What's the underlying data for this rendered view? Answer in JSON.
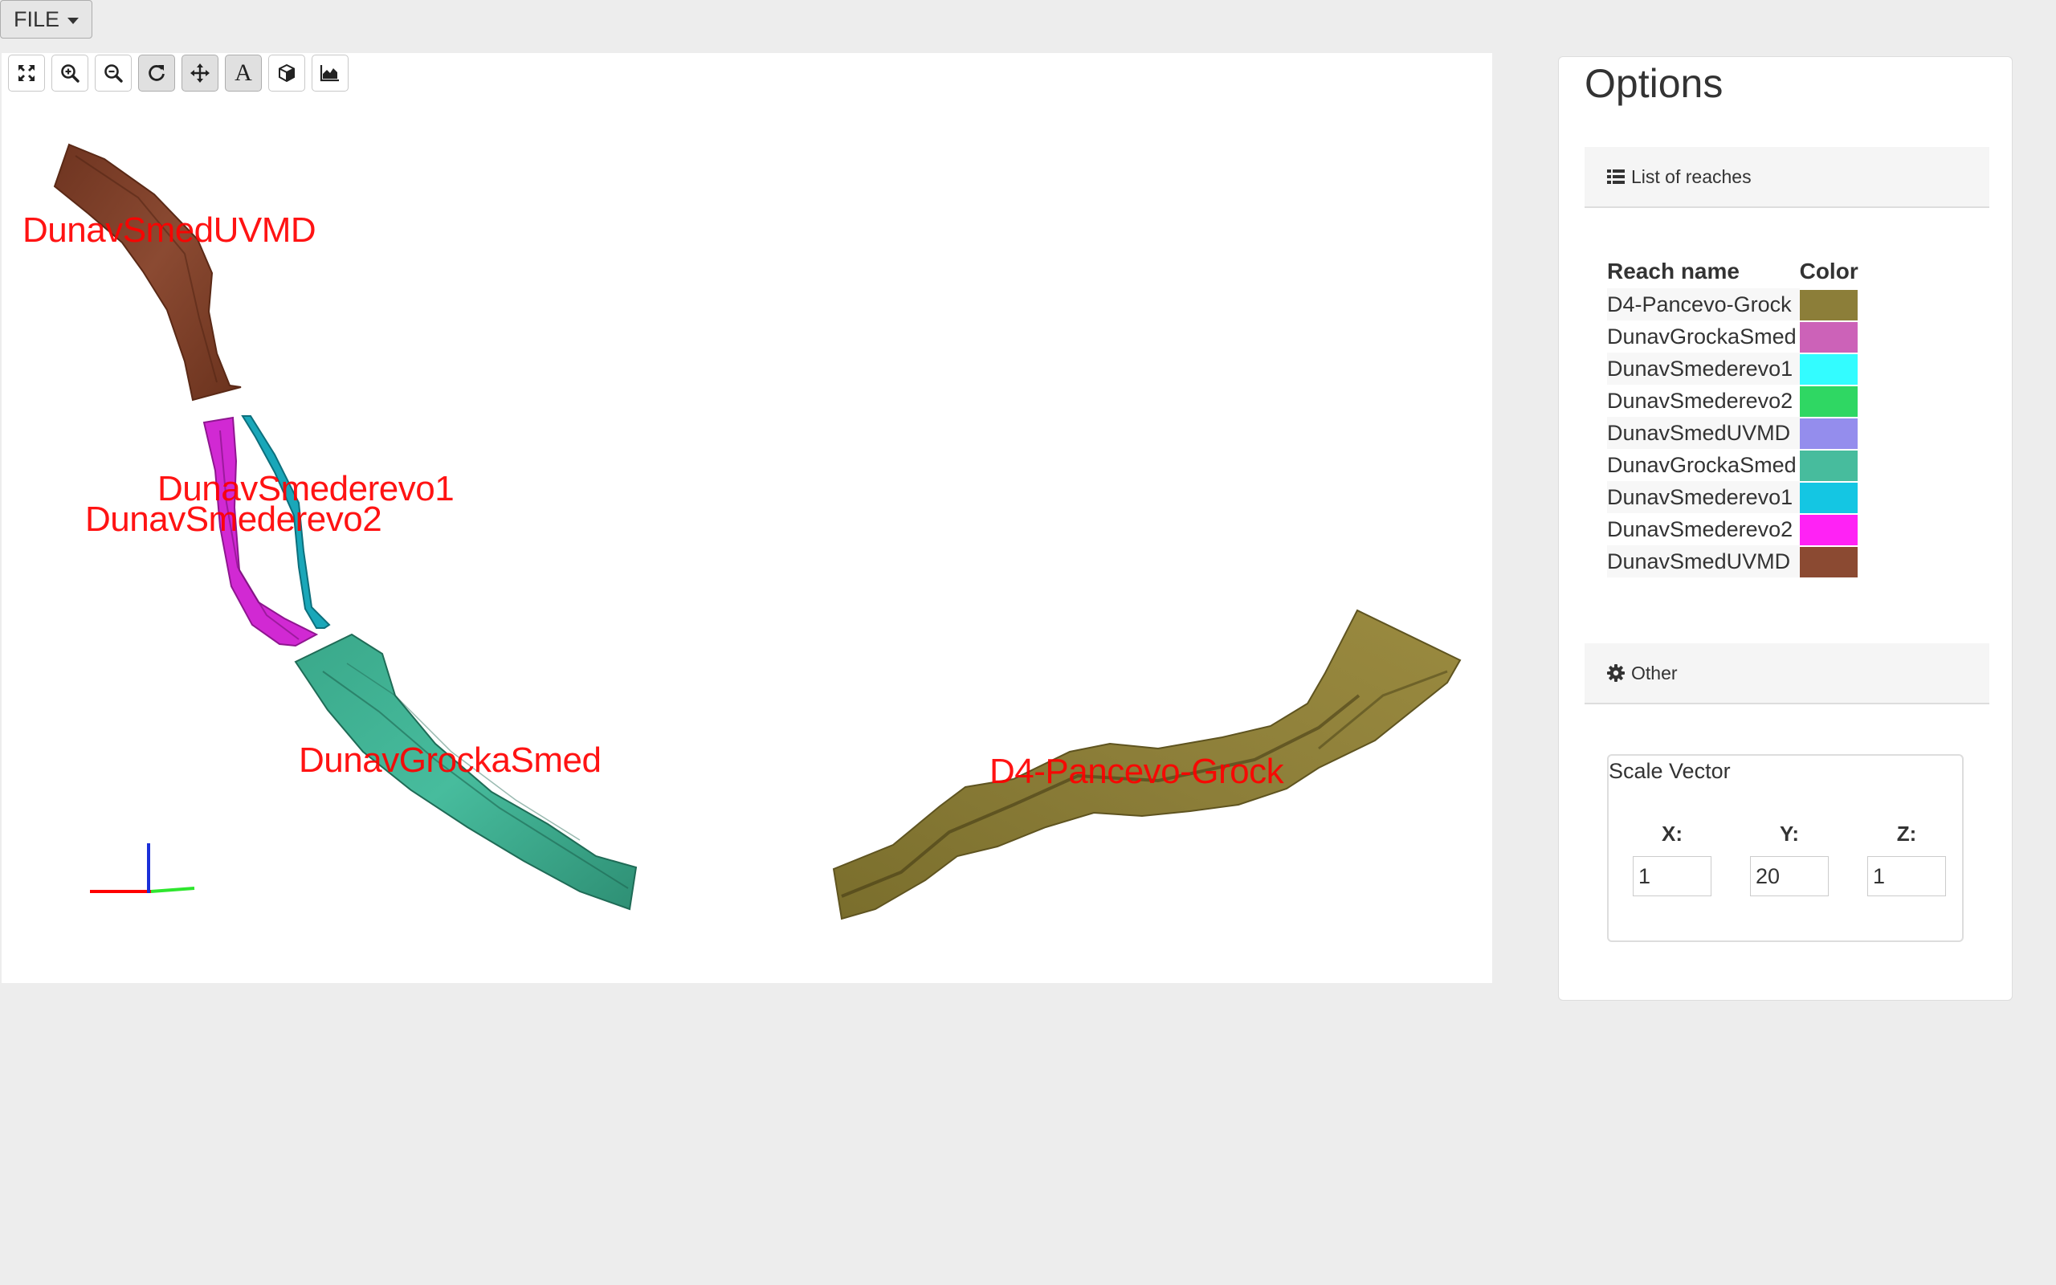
{
  "menu": {
    "file_label": "FILE"
  },
  "toolbar": {
    "buttons": [
      {
        "icon": "fullscreen-icon"
      },
      {
        "icon": "zoom-in-icon"
      },
      {
        "icon": "zoom-out-icon"
      },
      {
        "icon": "rotate-icon"
      },
      {
        "icon": "pan-icon"
      },
      {
        "icon": "text-labels-icon",
        "glyph": "A"
      },
      {
        "icon": "cube-icon"
      },
      {
        "icon": "area-chart-icon"
      }
    ]
  },
  "viewer": {
    "labels": [
      "DunavSmedUVMD",
      "DunavSmederevo1",
      "DunavSmederevo2",
      "DunavGrockaSmed",
      "D4-Pancevo-Grock"
    ]
  },
  "options": {
    "title": "Options",
    "reaches_header": "List of reaches",
    "table_headers": {
      "name": "Reach name",
      "color": "Color"
    },
    "reaches": [
      {
        "name": "D4-Pancevo-Grock",
        "color": "#8c7e39"
      },
      {
        "name": "DunavGrockaSmed",
        "color": "#cc62b8"
      },
      {
        "name": "DunavSmederevo1",
        "color": "#33fcff"
      },
      {
        "name": "DunavSmederevo2",
        "color": "#2fd763"
      },
      {
        "name": "DunavSmedUVMD",
        "color": "#948ded"
      },
      {
        "name": "DunavGrockaSmed",
        "color": "#47bc9d"
      },
      {
        "name": "DunavSmederevo1",
        "color": "#14c6e3"
      },
      {
        "name": "DunavSmederevo2",
        "color": "#ff22f5"
      },
      {
        "name": "DunavSmedUVMD",
        "color": "#8b4a32"
      }
    ],
    "other_header": "Other",
    "scale_vector": {
      "legend": "Scale Vector",
      "x_label": "X:",
      "x_value": "1",
      "y_label": "Y:",
      "y_value": "20",
      "z_label": "Z:",
      "z_value": "1"
    }
  }
}
